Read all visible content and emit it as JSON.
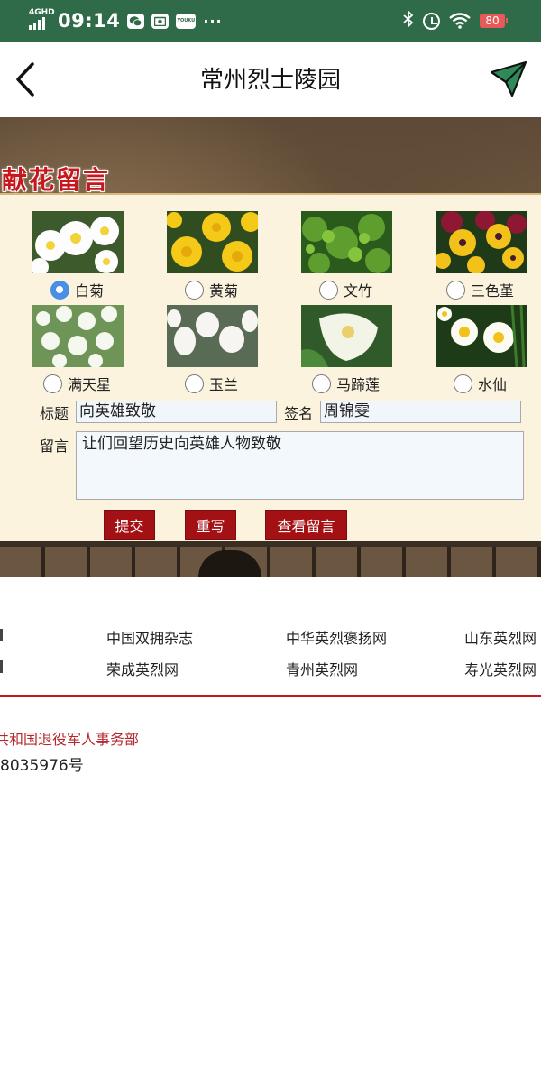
{
  "status_bar": {
    "network": "4GHD",
    "time": "09:14",
    "app_icons": [
      "wechat-icon",
      "camera-icon",
      "youku-icon"
    ],
    "youku_label": "YOUKU",
    "dots": "···",
    "battery": "80"
  },
  "nav": {
    "title": "常州烈士陵园",
    "back_icon": "chevron-left-icon",
    "share_icon": "paper-plane-icon"
  },
  "section": {
    "title": "献花留言"
  },
  "flowers": [
    {
      "label": "白菊",
      "selected": true
    },
    {
      "label": "黄菊",
      "selected": false
    },
    {
      "label": "文竹",
      "selected": false
    },
    {
      "label": "三色堇",
      "selected": false
    },
    {
      "label": "满天星",
      "selected": false
    },
    {
      "label": "玉兰",
      "selected": false
    },
    {
      "label": "马蹄莲",
      "selected": false
    },
    {
      "label": "水仙",
      "selected": false
    }
  ],
  "form": {
    "title_label": "标题",
    "title_value": "向英雄致敬",
    "sign_label": "签名",
    "sign_value": "周锦雯",
    "message_label": "留言",
    "message_value": "让们回望历史向英雄人物致敬"
  },
  "buttons": {
    "submit": "提交",
    "reset": "重写",
    "view": "查看留言"
  },
  "links": {
    "row1": [
      "中国双拥杂志",
      "中华英烈褒扬网",
      "山东英烈网"
    ],
    "row2": [
      "荣成英烈网",
      "青州英烈网",
      "寿光英烈网"
    ]
  },
  "footer": {
    "org": "共和国退役军人事务部",
    "icp": "8035976号"
  },
  "colors": {
    "status_bar": "#2f6b49",
    "accent_red": "#a41115",
    "panel": "#fbf3de",
    "radio_selected": "#4a8fe6"
  }
}
